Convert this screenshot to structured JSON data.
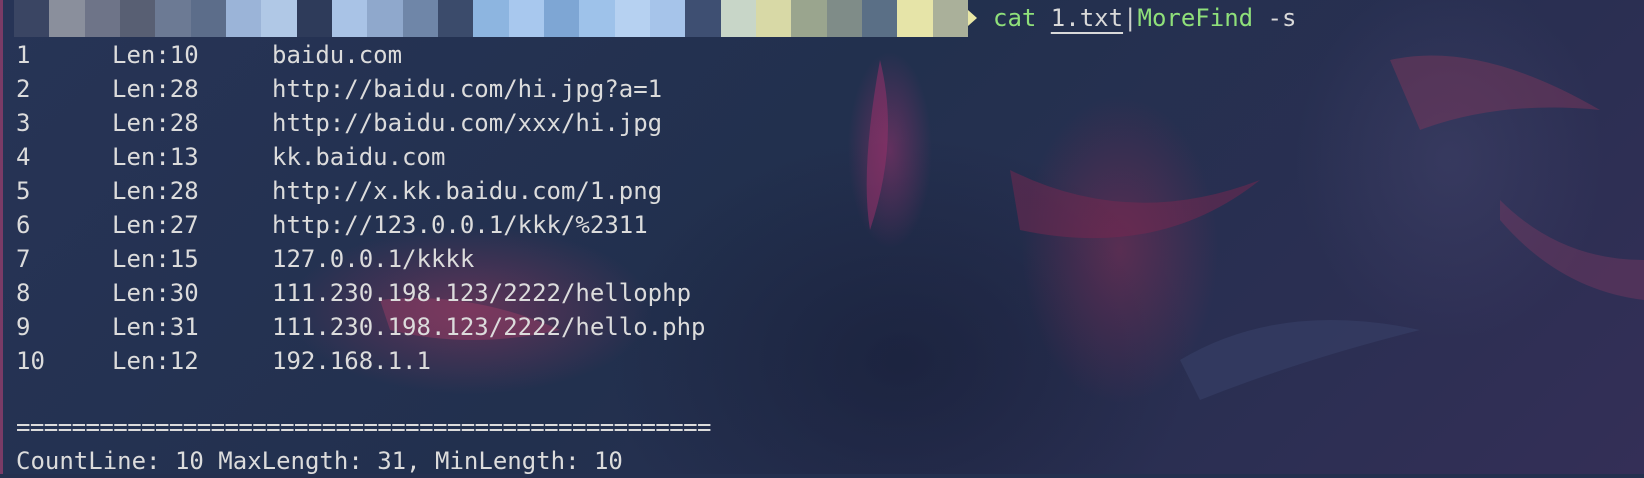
{
  "prompt": {
    "redacted_segment_colors": [
      "#3a4563",
      "#8a8f9c",
      "#6e7488",
      "#585f73",
      "#6c7a94",
      "#5c6d8a",
      "#9bb4d8",
      "#b0c8e6",
      "#2e3b5a",
      "#a9c3e6",
      "#8fa8cc",
      "#6f86a8",
      "#3b4b6b",
      "#8db5e0",
      "#a8c8ee",
      "#7ea6d4",
      "#9ec2ea",
      "#b6d1f1",
      "#a6c4ea",
      "#3e4f72",
      "#c8d6c8",
      "#d8d9a6",
      "#9aa58e",
      "#7f8c88",
      "#5a6f86",
      "#e6e4a8",
      "#aab09a"
    ],
    "arrow_icon": "prompt-arrow-icon",
    "command_name": "cat ",
    "command_arg": "1.txt",
    "pipe": "|",
    "pipe_command": "MoreFind",
    "flag": " -s"
  },
  "output": {
    "rows": [
      {
        "num": "1",
        "len": "Len:10",
        "value": "baidu.com"
      },
      {
        "num": "2",
        "len": "Len:28",
        "value": "http://baidu.com/hi.jpg?a=1"
      },
      {
        "num": "3",
        "len": "Len:28",
        "value": "http://baidu.com/xxx/hi.jpg"
      },
      {
        "num": "4",
        "len": "Len:13",
        "value": "kk.baidu.com"
      },
      {
        "num": "5",
        "len": "Len:28",
        "value": "http://x.kk.baidu.com/1.png"
      },
      {
        "num": "6",
        "len": "Len:27",
        "value": "http://123.0.0.1/kkk/%2311"
      },
      {
        "num": "7",
        "len": "Len:15",
        "value": "127.0.0.1/kkkk"
      },
      {
        "num": "8",
        "len": "Len:30",
        "value": "111.230.198.123/2222/hellophp"
      },
      {
        "num": "9",
        "len": "Len:31",
        "value": "111.230.198.123/2222/hello.php"
      },
      {
        "num": "10",
        "len": "Len:12",
        "value": "192.168.1.1"
      }
    ],
    "separator": "==================================================",
    "summary": "CountLine: 10 MaxLength: 31, MinLength: 10"
  }
}
